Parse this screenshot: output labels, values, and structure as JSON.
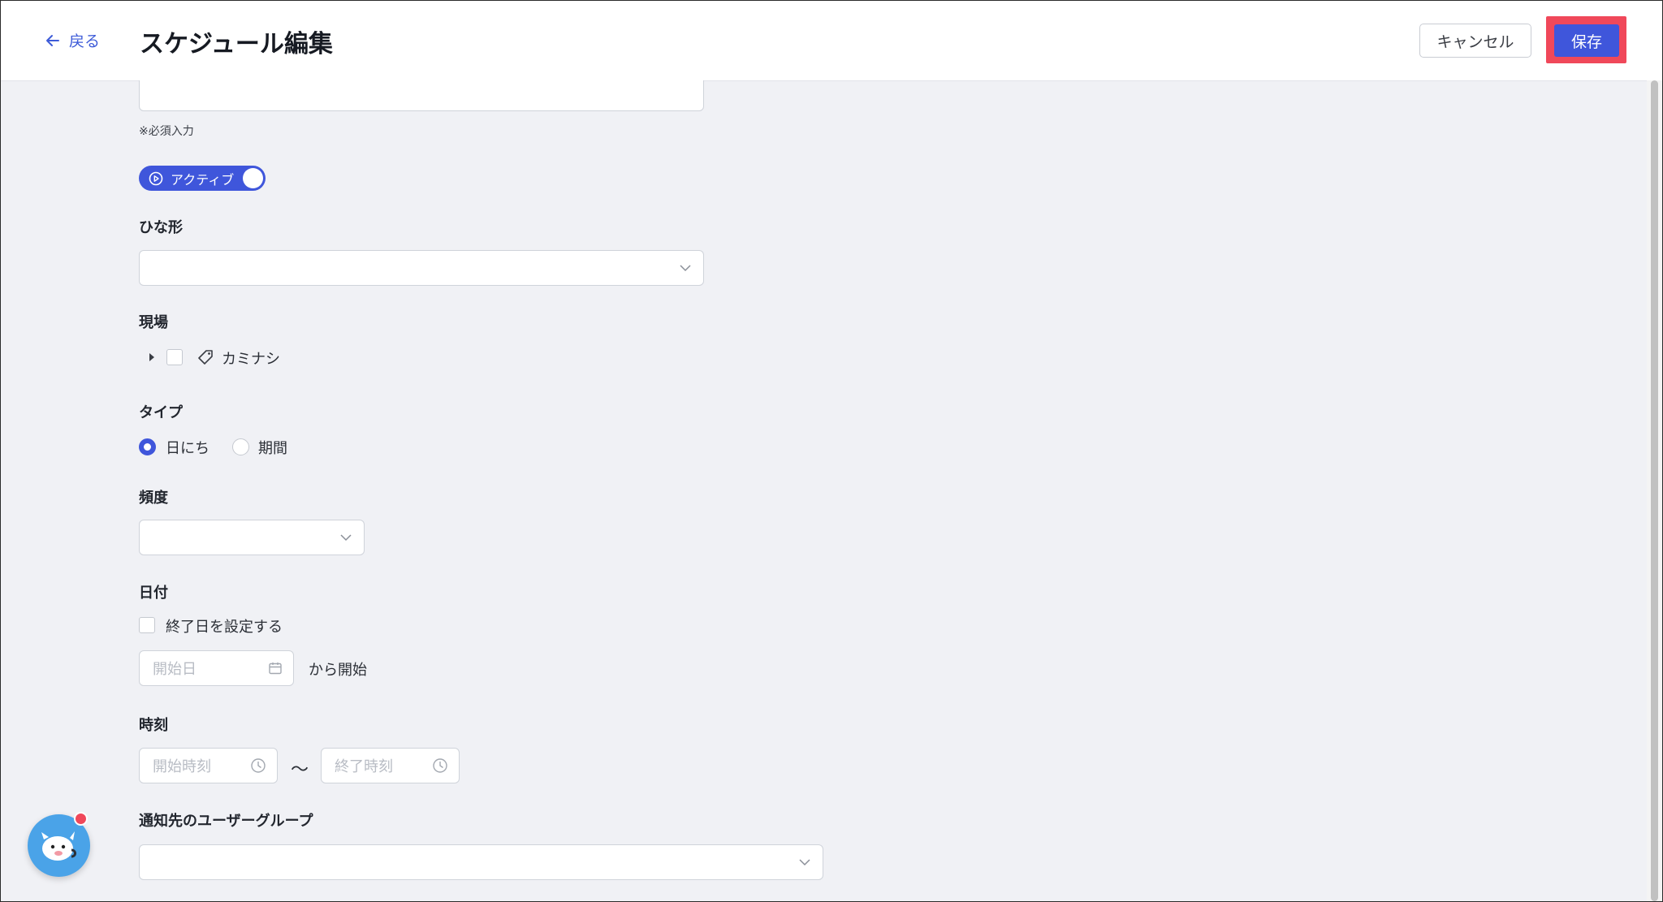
{
  "header": {
    "back_label": "戻る",
    "title": "スケジュール編集",
    "cancel_label": "キャンセル",
    "save_label": "保存"
  },
  "form": {
    "required_note": "※必須入力",
    "active_toggle": {
      "label": "アクティブ",
      "on": true
    },
    "template": {
      "label": "ひな形",
      "value": ""
    },
    "site": {
      "label": "現場",
      "tree_item_label": "カミナシ"
    },
    "type": {
      "label": "タイプ",
      "options": [
        "日にち",
        "期間"
      ],
      "selected": "日にち"
    },
    "frequency": {
      "label": "頻度",
      "value": ""
    },
    "date": {
      "label": "日付",
      "end_date_checkbox_label": "終了日を設定する",
      "start_date_placeholder": "開始日",
      "start_suffix": "から開始"
    },
    "time": {
      "label": "時刻",
      "start_placeholder": "開始時刻",
      "separator": "〜",
      "end_placeholder": "終了時刻"
    },
    "notify_group": {
      "label": "通知先のユーザーグループ",
      "value": ""
    }
  },
  "colors": {
    "accent": "#3f56db",
    "highlight": "#f0485a",
    "page_bg": "#f0f1f5",
    "chat_bubble": "#4aa3e8"
  },
  "icons": [
    "arrow-left-icon",
    "play-circle-icon",
    "chevron-down-icon",
    "caret-right-icon",
    "tag-icon",
    "calendar-icon",
    "clock-icon",
    "chat-mascot-icon"
  ]
}
